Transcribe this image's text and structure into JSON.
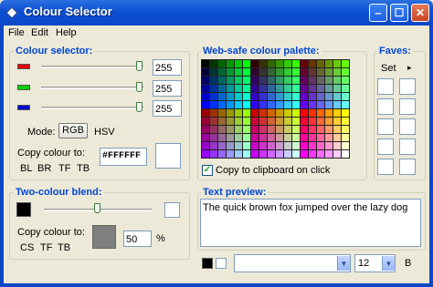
{
  "window": {
    "title": "Colour Selector",
    "minimize": "‒",
    "maximize": "☐",
    "close": "✕"
  },
  "menu": [
    "File",
    "Edit",
    "Help"
  ],
  "colour_selector": {
    "title": "Colour selector:",
    "channels": [
      {
        "swatch": "#e00000",
        "value": "255",
        "level": 1.0
      },
      {
        "swatch": "#00d000",
        "value": "255",
        "level": 1.0
      },
      {
        "swatch": "#0000d0",
        "value": "255",
        "level": 1.0
      }
    ],
    "mode_label": "Mode:",
    "mode_rgb": "RGB",
    "mode_hsv": "HSV",
    "copy_label": "Copy colour to:",
    "copy_targets": [
      "BL",
      "BR",
      "TF",
      "TB"
    ],
    "hex_value": "#FFFFFF",
    "preview_color": "#ffffff"
  },
  "palette": {
    "title": "Web-safe colour palette:",
    "copy_checkbox_label": "Copy to clipboard on click",
    "copy_checked": true
  },
  "faves": {
    "title": "Faves:",
    "set_label": "Set",
    "arrow": "▸"
  },
  "blend": {
    "title": "Two-colour blend:",
    "left_color": "#000000",
    "right_color": "#ffffff",
    "copy_label": "Copy colour to:",
    "copy_targets": [
      "CS",
      "TF",
      "TB"
    ],
    "blend_color": "#7f7f7f",
    "percent_value": "50",
    "percent_symbol": "%",
    "level": 0.5
  },
  "preview": {
    "title": "Text preview:",
    "text": "The quick brown fox jumped over the lazy dog",
    "fg": "#000000",
    "bg": "#ffffff",
    "font_value": "",
    "size_value": "12",
    "bold_label": "B"
  }
}
